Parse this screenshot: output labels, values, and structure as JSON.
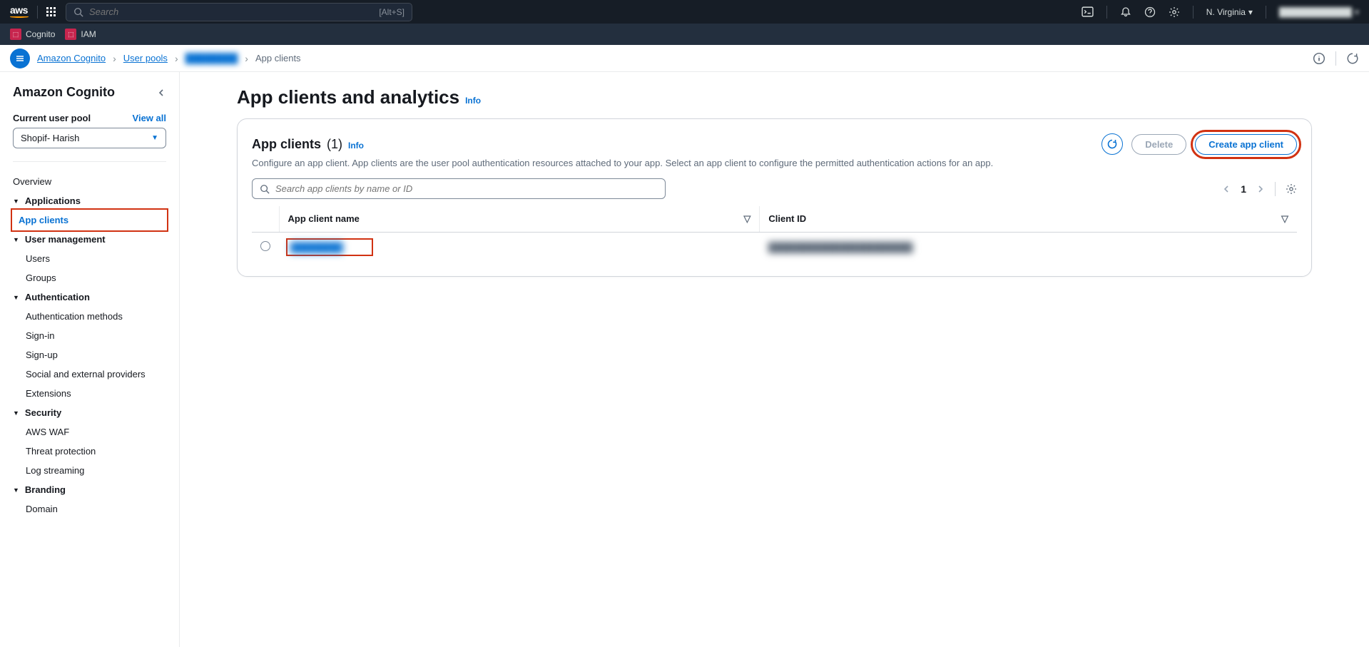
{
  "topbar": {
    "logo_text": "aws",
    "search_placeholder": "Search",
    "search_shortcut": "[Alt+S]",
    "region": "N. Virginia",
    "account": "████████████"
  },
  "servicebar": {
    "items": [
      {
        "label": "Cognito"
      },
      {
        "label": "IAM"
      }
    ]
  },
  "breadcrumb": {
    "items": [
      {
        "label": "Amazon Cognito",
        "link": true
      },
      {
        "label": "User pools",
        "link": true
      },
      {
        "label": "████████",
        "blurred": true
      },
      {
        "label": "App clients",
        "current": true
      }
    ]
  },
  "sidebar": {
    "title": "Amazon Cognito",
    "pool_label": "Current user pool",
    "view_all": "View all",
    "pool_selected": "Shopif- Harish",
    "overview": "Overview",
    "sections": [
      {
        "label": "Applications",
        "items": [
          {
            "label": "App clients",
            "active": true,
            "highlighted": true
          }
        ]
      },
      {
        "label": "User management",
        "items": [
          {
            "label": "Users"
          },
          {
            "label": "Groups"
          }
        ]
      },
      {
        "label": "Authentication",
        "items": [
          {
            "label": "Authentication methods"
          },
          {
            "label": "Sign-in"
          },
          {
            "label": "Sign-up"
          },
          {
            "label": "Social and external providers"
          },
          {
            "label": "Extensions"
          }
        ]
      },
      {
        "label": "Security",
        "items": [
          {
            "label": "AWS WAF"
          },
          {
            "label": "Threat protection"
          },
          {
            "label": "Log streaming"
          }
        ]
      },
      {
        "label": "Branding",
        "items": [
          {
            "label": "Domain"
          }
        ]
      }
    ]
  },
  "page": {
    "title": "App clients and analytics",
    "info": "Info"
  },
  "panel": {
    "title": "App clients",
    "count": "(1)",
    "info": "Info",
    "description": "Configure an app client. App clients are the user pool authentication resources attached to your app. Select an app client to configure the permitted authentication actions for an app.",
    "delete_label": "Delete",
    "create_label": "Create app client",
    "search_placeholder": "Search app clients by name or ID",
    "page_num": "1",
    "columns": {
      "name": "App client name",
      "id": "Client ID"
    },
    "rows": [
      {
        "name": "████████",
        "id": "██████████████████████"
      }
    ]
  }
}
